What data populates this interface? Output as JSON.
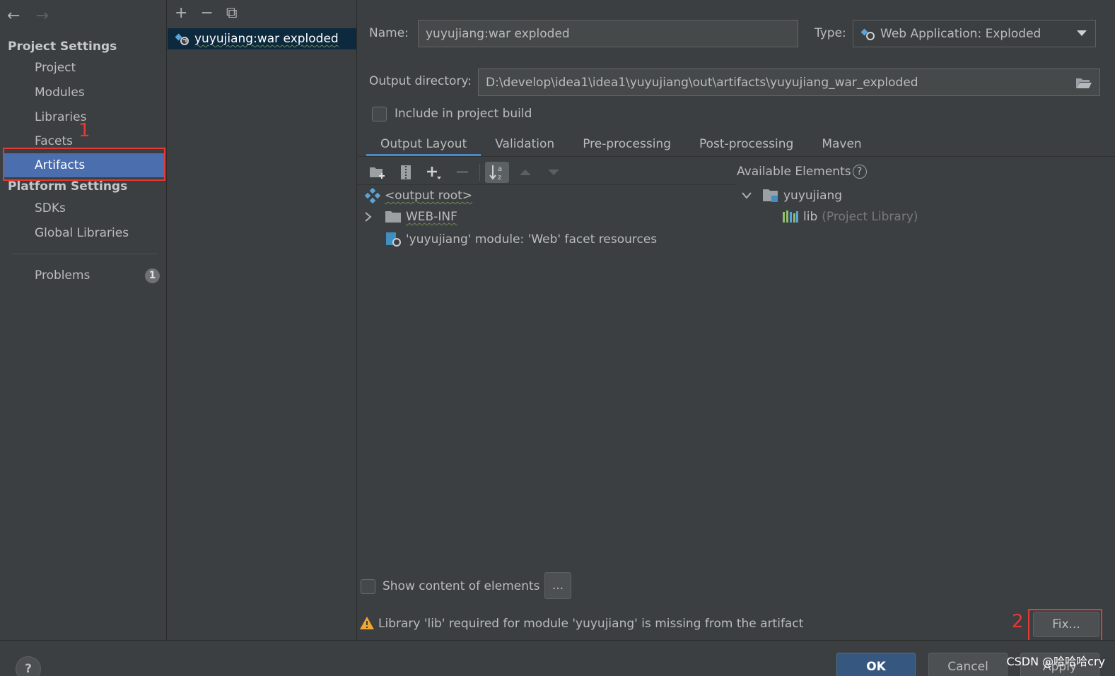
{
  "sidebar": {
    "back_icon": "←",
    "forward_icon": "→",
    "project_settings_title": "Project Settings",
    "project_items": [
      "Project",
      "Modules",
      "Libraries",
      "Facets",
      "Artifacts"
    ],
    "platform_settings_title": "Platform Settings",
    "platform_items": [
      "SDKs",
      "Global Libraries"
    ],
    "problems_label": "Problems",
    "problems_count": "1",
    "annotation_1": "1"
  },
  "artifact_list": {
    "add_icon": "+",
    "remove_icon": "−",
    "copy_icon": "⧉",
    "items": [
      "yuyujiang:war exploded"
    ]
  },
  "form": {
    "name_label": "Name:",
    "name_value": "yuyujiang:war exploded",
    "type_label": "Type:",
    "type_value": "Web Application: Exploded",
    "output_dir_label": "Output directory:",
    "output_dir_value": "D:\\develop\\idea1\\idea1\\yuyujiang\\out\\artifacts\\yuyujiang_war_exploded",
    "include_build_label": "Include in project build"
  },
  "tabs": [
    "Output Layout",
    "Validation",
    "Pre-processing",
    "Post-processing",
    "Maven"
  ],
  "output_tree": {
    "root": "<output root>",
    "webinf": "WEB-INF",
    "facet_resources": "'yuyujiang' module: 'Web' facet resources"
  },
  "available": {
    "title": "Available Elements",
    "help_icon": "?",
    "module": "yuyujiang",
    "lib_name": "lib",
    "lib_suffix": "(Project Library)"
  },
  "show_content_label": "Show content of elements",
  "ellipsis_button": "...",
  "warning_text": "Library 'lib' required for module 'yuyujiang' is missing from the artifact",
  "fix_button": "Fix...",
  "annotation_2": "2",
  "footer": {
    "help": "?",
    "ok": "OK",
    "cancel": "Cancel",
    "apply": "Apply",
    "watermark": "CSDN @哈哈哈cry"
  },
  "colors": {
    "background": "#3c3f41",
    "selection": "#4b6eaf",
    "list_selection": "#0d293e",
    "annotation_red": "#e53935",
    "primary_button": "#365880",
    "warning": "#f0a732"
  }
}
